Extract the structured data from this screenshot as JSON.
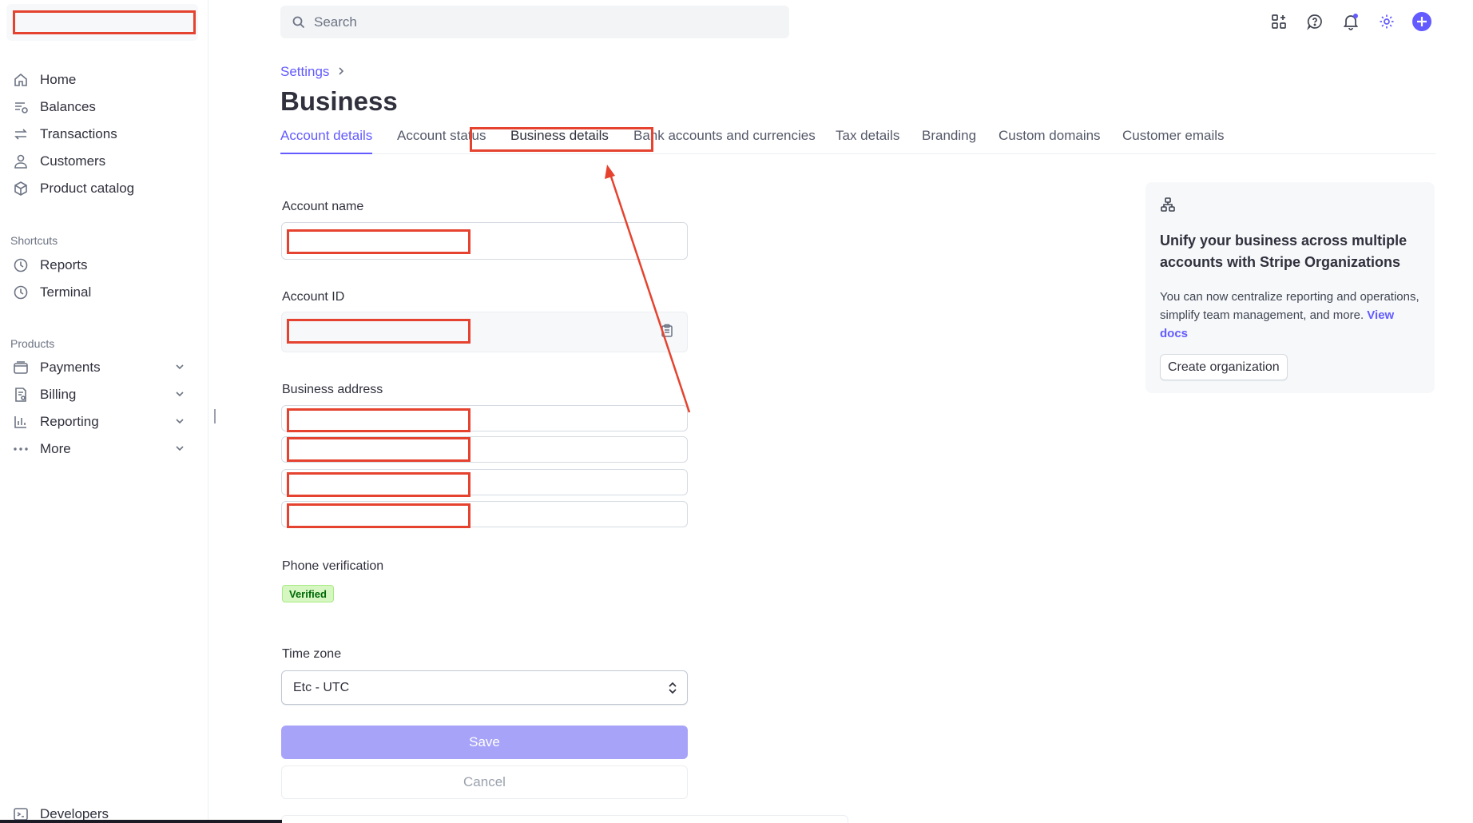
{
  "search": {
    "placeholder": "Search"
  },
  "sidebar": {
    "main_items": [
      {
        "label": "Home",
        "icon": "home-icon"
      },
      {
        "label": "Balances",
        "icon": "balances-icon"
      },
      {
        "label": "Transactions",
        "icon": "transactions-icon"
      },
      {
        "label": "Customers",
        "icon": "person-icon"
      },
      {
        "label": "Product catalog",
        "icon": "box-icon"
      }
    ],
    "shortcuts_title": "Shortcuts",
    "shortcuts": [
      {
        "label": "Reports",
        "icon": "clock-icon"
      },
      {
        "label": "Terminal",
        "icon": "clock-icon"
      }
    ],
    "products_title": "Products",
    "products": [
      {
        "label": "Payments",
        "icon": "wallet-icon"
      },
      {
        "label": "Billing",
        "icon": "billing-icon"
      },
      {
        "label": "Reporting",
        "icon": "bar-chart-icon"
      },
      {
        "label": "More",
        "icon": "ellipsis-icon"
      }
    ],
    "developers": {
      "label": "Developers",
      "icon": "terminal-icon"
    }
  },
  "breadcrumb": {
    "parent": "Settings"
  },
  "page_title": "Business",
  "tabs": [
    {
      "label": "Account details",
      "active": true
    },
    {
      "label": "Account status"
    },
    {
      "label": "Business details"
    },
    {
      "label": "Bank accounts and currencies"
    },
    {
      "label": "Tax details"
    },
    {
      "label": "Branding"
    },
    {
      "label": "Custom domains"
    },
    {
      "label": "Customer emails"
    }
  ],
  "form": {
    "account_name_label": "Account name",
    "account_id_label": "Account ID",
    "business_address_label": "Business address",
    "phone_verification_label": "Phone verification",
    "phone_status": "Verified",
    "time_zone_label": "Time zone",
    "time_zone_value": "Etc - UTC",
    "save_label": "Save",
    "cancel_label": "Cancel"
  },
  "promo": {
    "title": "Unify your business across multiple accounts with Stripe Organizations",
    "body": "You can now centralize reporting and operations, simplify team management, and more.",
    "link": "View docs",
    "button": "Create organization"
  },
  "colors": {
    "accent": "#635bff",
    "annotation": "#e5432f",
    "verified_bg": "#d7f7c2",
    "verified_text": "#006908"
  }
}
